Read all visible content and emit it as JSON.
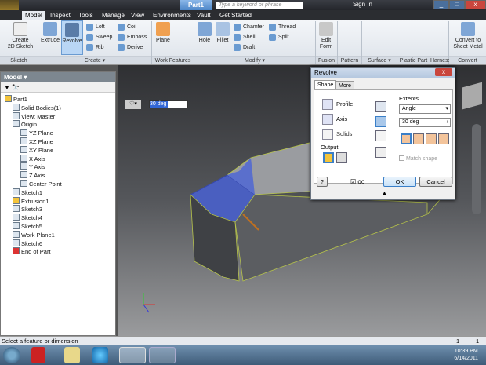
{
  "app": {
    "title": "Part1",
    "search_placeholder": "Type a keyword or phrase",
    "sign_in": "Sign In"
  },
  "tabs": [
    "Model",
    "Inspect",
    "Tools",
    "Manage",
    "View",
    "Environments",
    "Vault",
    "Get Started"
  ],
  "ribbon": {
    "create_sketch": "Create\n2D Sketch",
    "extrude": "Extrude",
    "revolve": "Revolve",
    "loft": "Loft",
    "sweep": "Sweep",
    "rib": "Rib",
    "coil": "Coil",
    "emboss": "Emboss",
    "derive": "Derive",
    "plane": "Plane",
    "hole": "Hole",
    "fillet": "Fillet",
    "chamfer": "Chamfer",
    "shell": "Shell",
    "draft": "Draft",
    "thread": "Thread",
    "split": "Split",
    "edit_form": "Edit\nForm",
    "convert": "Convert to\nSheet Metal",
    "groups": [
      "Sketch",
      "Create ▾",
      "Work Features",
      "Modify ▾",
      "Fusion",
      "Pattern",
      "Surface ▾",
      "Plastic Part",
      "Harness",
      "Convert"
    ]
  },
  "browser": {
    "title": "Model ▾",
    "items": [
      "Part1",
      "Solid Bodies(1)",
      "View: Master",
      "Origin",
      "YZ Plane",
      "XZ Plane",
      "XY Plane",
      "X Axis",
      "Y Axis",
      "Z Axis",
      "Center Point",
      "Sketch1",
      "Extrusion1",
      "Sketch3",
      "Sketch4",
      "Sketch5",
      "Work Plane1",
      "Sketch6",
      "End of Part"
    ]
  },
  "viewport": {
    "angle_value": "30 deg"
  },
  "dialog": {
    "title": "Revolve",
    "tabs": [
      "Shape",
      "More"
    ],
    "profile": "Profile",
    "axis": "Axis",
    "solids": "Solids",
    "output": "Output",
    "extents": "Extents",
    "extents_type": "Angle",
    "angle": "30 deg",
    "match_shape": "Match shape",
    "ok": "OK",
    "cancel": "Cancel"
  },
  "status": {
    "text": "Select a feature or dimension",
    "count1": "1",
    "count2": "1"
  },
  "clock": {
    "time": "10:39 PM",
    "date": "6/14/2011"
  },
  "colors": {
    "accent": "#4d86c8",
    "face_selected": "#4a5fc0",
    "part_body": "#5b5d61"
  }
}
